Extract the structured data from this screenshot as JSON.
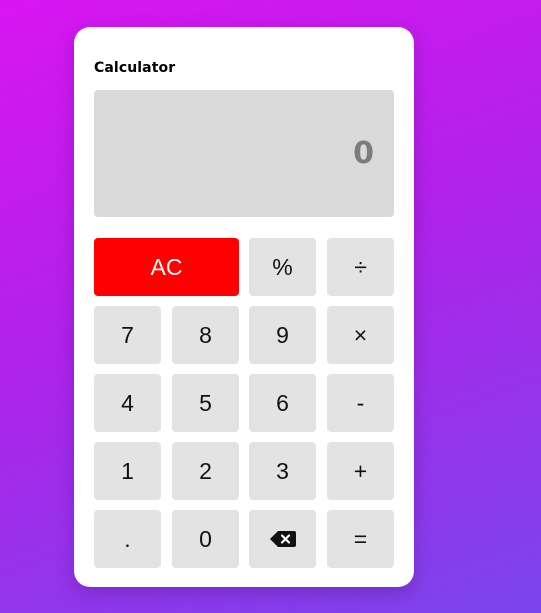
{
  "app": {
    "title": "Calculator"
  },
  "display": {
    "value": "0"
  },
  "colors": {
    "background_gradient_start": "#d915f2",
    "background_gradient_end": "#7b45ec",
    "clear_button": "#ff0000",
    "key_background": "#e3e3e3",
    "display_background": "#dadada"
  },
  "keys": [
    {
      "label": "AC",
      "name": "all-clear-button"
    },
    {
      "label": "%",
      "name": "percent-button"
    },
    {
      "label": "÷",
      "name": "divide-button"
    },
    {
      "label": "7",
      "name": "digit-7-button"
    },
    {
      "label": "8",
      "name": "digit-8-button"
    },
    {
      "label": "9",
      "name": "digit-9-button"
    },
    {
      "label": "×",
      "name": "multiply-button"
    },
    {
      "label": "4",
      "name": "digit-4-button"
    },
    {
      "label": "5",
      "name": "digit-5-button"
    },
    {
      "label": "6",
      "name": "digit-6-button"
    },
    {
      "label": "-",
      "name": "subtract-button"
    },
    {
      "label": "1",
      "name": "digit-1-button"
    },
    {
      "label": "2",
      "name": "digit-2-button"
    },
    {
      "label": "3",
      "name": "digit-3-button"
    },
    {
      "label": "+",
      "name": "add-button"
    },
    {
      "label": ".",
      "name": "decimal-button"
    },
    {
      "label": "0",
      "name": "digit-0-button"
    },
    {
      "label": "",
      "name": "backspace-button",
      "icon": "backspace-icon"
    },
    {
      "label": "=",
      "name": "equals-button"
    }
  ]
}
